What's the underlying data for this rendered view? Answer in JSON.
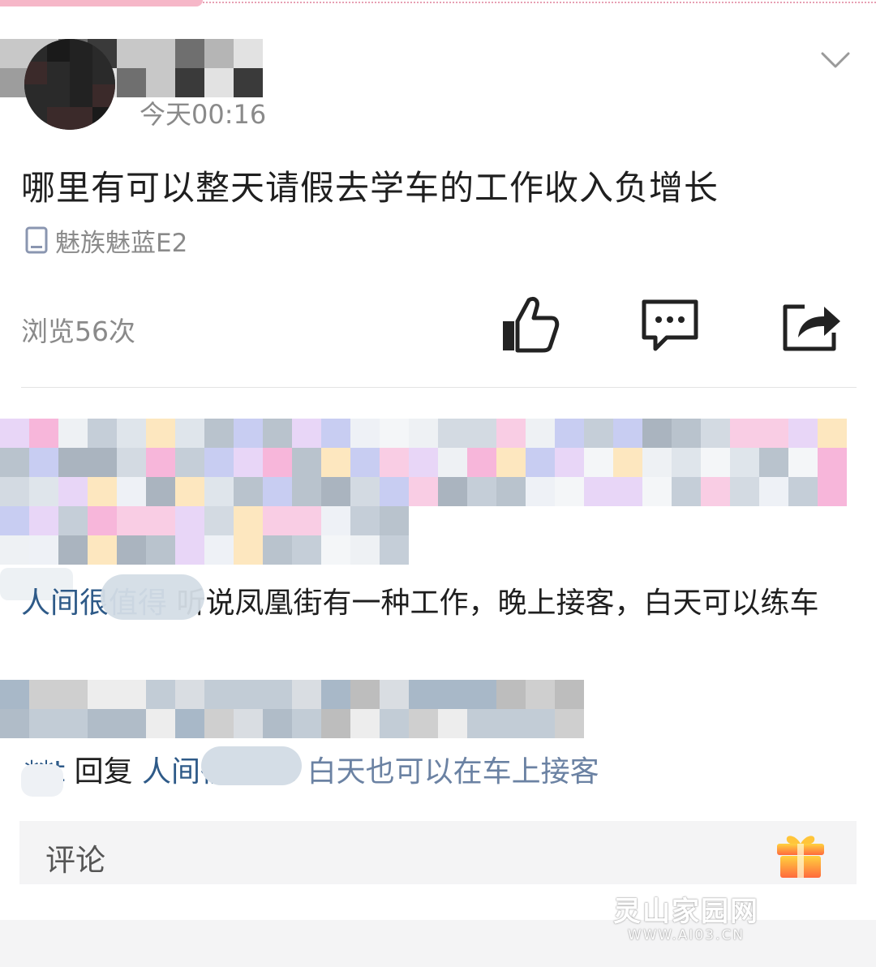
{
  "post": {
    "time": "今天00:16",
    "text": "哪里有可以整天请假去学车的工作收入负增长",
    "device": "魅族魅蓝E2",
    "views": "浏览56次"
  },
  "actions": {
    "like_icon": "thumbs-up-icon",
    "comment_icon": "comment-bubble-icon",
    "share_icon": "share-icon",
    "more_icon": "chevron-down-icon"
  },
  "comments": [
    {
      "author": "人间很值得",
      "text": "听说凤凰街有一种工作，晚上接客，白天可以练车"
    }
  ],
  "reply": {
    "user": "**t",
    "verb": "回复",
    "target": "人间很值得",
    "colon": ":",
    "text": "白天也可以在车上接客"
  },
  "comment_box": {
    "placeholder": "评论",
    "gift_icon": "gift-icon"
  },
  "watermark": {
    "main": "灵山家园网",
    "sub": "WWW.AI03.CN"
  }
}
